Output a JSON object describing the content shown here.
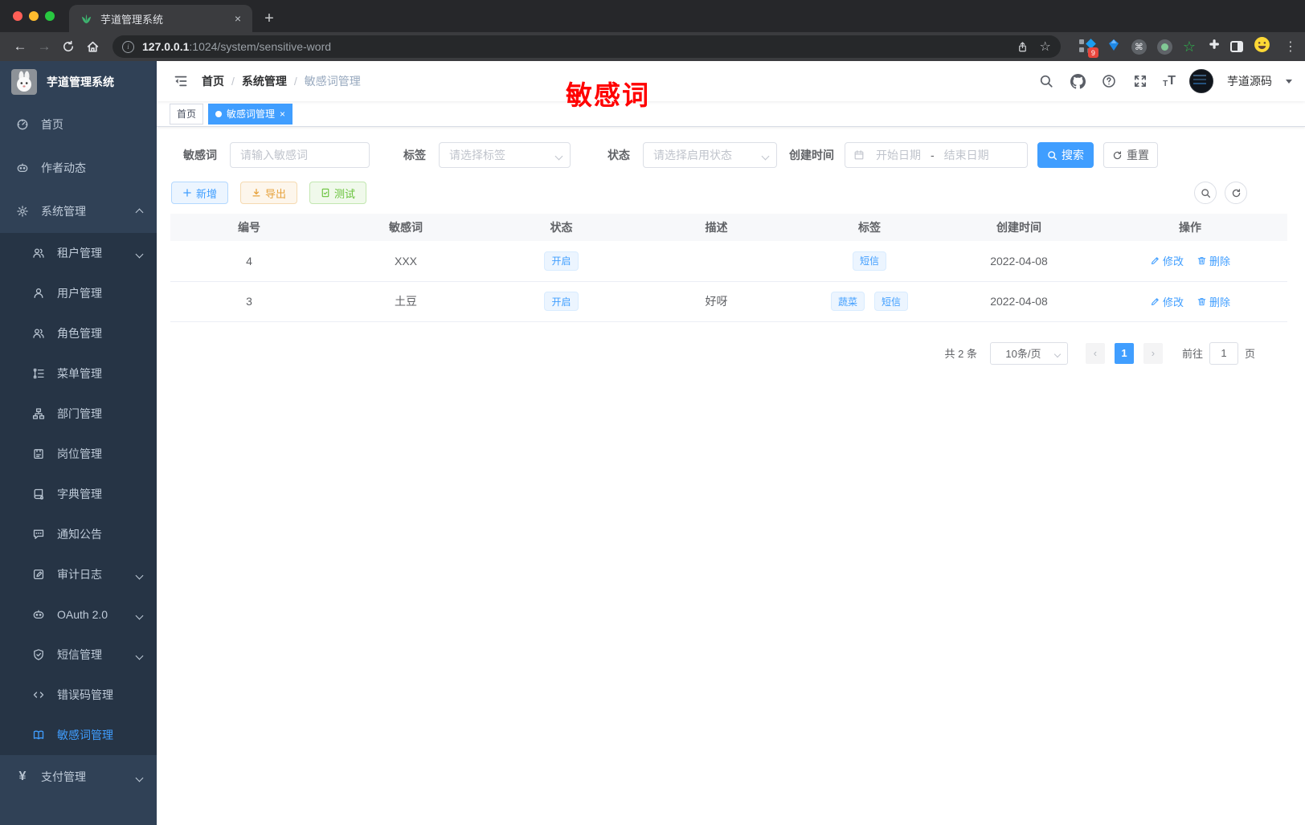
{
  "browser": {
    "tab_title": "芋道管理系统",
    "url_host": "127.0.0.1",
    "url_rest": ":1024/system/sensitive-word",
    "extension_badge": "9"
  },
  "sidebar": {
    "title": "芋道管理系统",
    "items": [
      {
        "label": "首页"
      },
      {
        "label": "作者动态"
      },
      {
        "label": "系统管理"
      },
      {
        "label": "租户管理"
      },
      {
        "label": "用户管理"
      },
      {
        "label": "角色管理"
      },
      {
        "label": "菜单管理"
      },
      {
        "label": "部门管理"
      },
      {
        "label": "岗位管理"
      },
      {
        "label": "字典管理"
      },
      {
        "label": "通知公告"
      },
      {
        "label": "审计日志"
      },
      {
        "label": "OAuth 2.0"
      },
      {
        "label": "短信管理"
      },
      {
        "label": "错误码管理"
      },
      {
        "label": "敏感词管理"
      },
      {
        "label": "支付管理"
      }
    ]
  },
  "navbar": {
    "breadcrumb": {
      "home": "首页",
      "separator": "/",
      "section": "系统管理",
      "current": "敏感词管理"
    },
    "username": "芋道源码"
  },
  "annotation": {
    "text": "敏感词",
    "color": "#ff0000"
  },
  "tags_bar": {
    "tags": [
      {
        "label": "首页",
        "active": false
      },
      {
        "label": "敏感词管理",
        "active": true
      }
    ]
  },
  "filters": {
    "word": {
      "label": "敏感词",
      "placeholder": "请输入敏感词"
    },
    "tag": {
      "label": "标签",
      "placeholder": "请选择标签"
    },
    "status": {
      "label": "状态",
      "placeholder": "请选择启用状态"
    },
    "date": {
      "label": "创建时间",
      "start_placeholder": "开始日期",
      "separator": "-",
      "end_placeholder": "结束日期"
    },
    "search_label": "搜索",
    "reset_label": "重置"
  },
  "toolbar": {
    "add_label": "新增",
    "export_label": "导出",
    "test_label": "测试"
  },
  "table": {
    "columns": [
      "编号",
      "敏感词",
      "状态",
      "描述",
      "标签",
      "创建时间",
      "操作"
    ],
    "rows": [
      {
        "id": "4",
        "word": "XXX",
        "status": "开启",
        "description": "",
        "tags": [
          "短信"
        ],
        "created_at": "2022-04-08",
        "edit_label": "修改",
        "delete_label": "删除"
      },
      {
        "id": "3",
        "word": "土豆",
        "status": "开启",
        "description": "好呀",
        "tags": [
          "蔬菜",
          "短信"
        ],
        "created_at": "2022-04-08",
        "edit_label": "修改",
        "delete_label": "删除"
      }
    ]
  },
  "pagination": {
    "total_text": "共 2 条",
    "page_size_text": "10条/页",
    "prev_icon": "‹",
    "next_icon": "›",
    "current_page": "1",
    "goto_label": "前往",
    "goto_value": "1",
    "goto_suffix": "页"
  },
  "colors": {
    "primary": "#409eff",
    "sidebar_bg": "#304156",
    "submenu_bg": "#263445",
    "tag_bg": "#ecf5ff",
    "annotation_red": "#ff0000"
  }
}
